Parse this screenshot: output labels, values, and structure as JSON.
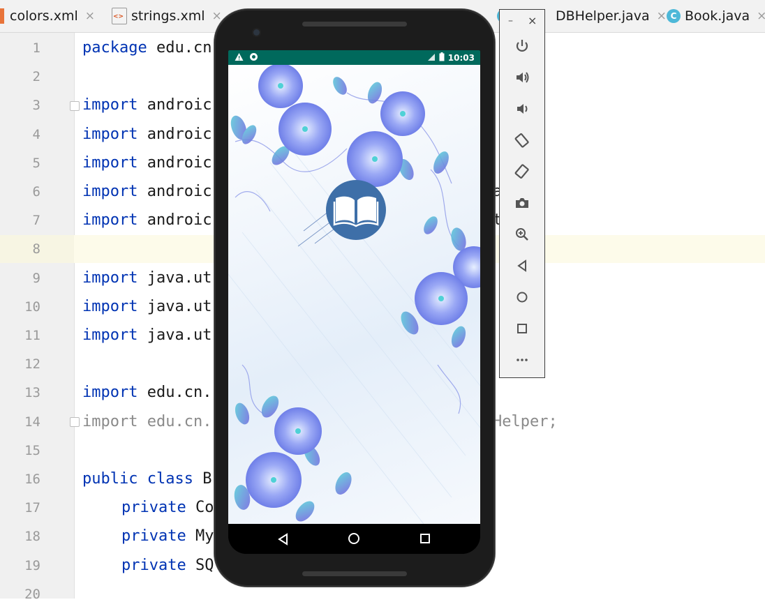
{
  "tabs": [
    {
      "label": "colors.xml",
      "close": "×"
    },
    {
      "label": "strings.xml",
      "close": "×"
    },
    {
      "label": "DBHelper.java",
      "close": "×",
      "icon_letter": "C"
    },
    {
      "label": "Book.java",
      "close": "×",
      "icon_letter": "C"
    }
  ],
  "editor": {
    "highlighted_line": 8,
    "lines": [
      {
        "n": "1",
        "kw": "package",
        "rest": " edu.cn",
        "tail": ""
      },
      {
        "n": "2",
        "kw": "",
        "rest": "",
        "tail": ""
      },
      {
        "n": "3",
        "kw": "import",
        "rest": " androic",
        "tail": ""
      },
      {
        "n": "4",
        "kw": "import",
        "rest": " androic",
        "tail": ""
      },
      {
        "n": "5",
        "kw": "import",
        "rest": " androic",
        "tail": ""
      },
      {
        "n": "6",
        "kw": "import",
        "rest": " androic",
        "tail": "a"
      },
      {
        "n": "7",
        "kw": "import",
        "rest": " androic",
        "tail": "t"
      },
      {
        "n": "8",
        "kw": "",
        "rest": "",
        "tail": ""
      },
      {
        "n": "9",
        "kw": "import",
        "rest": " java.ut",
        "tail": ""
      },
      {
        "n": "10",
        "kw": "import",
        "rest": " java.ut",
        "tail": ""
      },
      {
        "n": "11",
        "kw": "import",
        "rest": " java.ut",
        "tail": ""
      },
      {
        "n": "12",
        "kw": "",
        "rest": "",
        "tail": ""
      },
      {
        "n": "13",
        "kw": "import",
        "rest": " edu.cn.",
        "tail": ""
      },
      {
        "n": "14",
        "kw": "import",
        "rest": " edu.cn.",
        "tail": "Helper;"
      },
      {
        "n": "15",
        "kw": "",
        "rest": "",
        "tail": ""
      },
      {
        "n": "16",
        "kw": "public class",
        "rest": " B",
        "tail": ""
      },
      {
        "n": "17",
        "kw": "private",
        "rest": " Co",
        "tail": ""
      },
      {
        "n": "18",
        "kw": "private",
        "rest": " My",
        "tail": ""
      },
      {
        "n": "19",
        "kw": "private",
        "rest": " SQ",
        "tail": ""
      },
      {
        "n": "20",
        "kw": "",
        "rest": "",
        "tail": ""
      }
    ]
  },
  "emulator": {
    "status_time": "10:03",
    "toolbar": {
      "minimize": "–",
      "close": "×",
      "buttons": [
        "power-icon",
        "volume-up-icon",
        "volume-down-icon",
        "rotate-left-icon",
        "rotate-right-icon",
        "camera-icon",
        "zoom-icon",
        "back-icon",
        "home-icon",
        "overview-icon",
        "more-icon"
      ]
    },
    "accent_colors": {
      "status_bar": "#00695c",
      "logo": "#3e6fa8",
      "flowers": "#7b8cf0"
    }
  }
}
